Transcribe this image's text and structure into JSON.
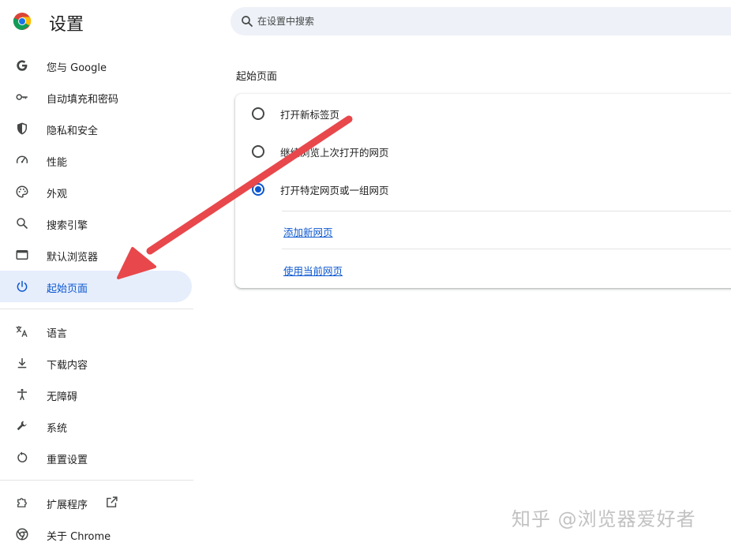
{
  "app": {
    "title": "设置"
  },
  "search": {
    "placeholder": "在设置中搜索",
    "value": ""
  },
  "sidebar": {
    "items": [
      {
        "id": "you-and-google",
        "label": "您与 Google",
        "icon": "google-g-icon"
      },
      {
        "id": "autofill",
        "label": "自动填充和密码",
        "icon": "key-icon"
      },
      {
        "id": "privacy",
        "label": "隐私和安全",
        "icon": "shield-icon"
      },
      {
        "id": "performance",
        "label": "性能",
        "icon": "speedometer-icon"
      },
      {
        "id": "appearance",
        "label": "外观",
        "icon": "palette-icon"
      },
      {
        "id": "search-engine",
        "label": "搜索引擎",
        "icon": "search-icon"
      },
      {
        "id": "default-browser",
        "label": "默认浏览器",
        "icon": "browser-window-icon"
      },
      {
        "id": "on-startup",
        "label": "起始页面",
        "icon": "power-icon",
        "active": true
      },
      {
        "id": "languages",
        "label": "语言",
        "icon": "translate-icon"
      },
      {
        "id": "downloads",
        "label": "下载内容",
        "icon": "download-icon"
      },
      {
        "id": "accessibility",
        "label": "无障碍",
        "icon": "accessibility-icon"
      },
      {
        "id": "system",
        "label": "系统",
        "icon": "wrench-icon"
      },
      {
        "id": "reset",
        "label": "重置设置",
        "icon": "reset-icon"
      },
      {
        "id": "extensions",
        "label": "扩展程序",
        "icon": "puzzle-icon"
      },
      {
        "id": "about",
        "label": "关于 Chrome",
        "icon": "chrome-icon"
      }
    ]
  },
  "main": {
    "section_title": "起始页面",
    "options": [
      {
        "label": "打开新标签页",
        "checked": false
      },
      {
        "label": "继续浏览上次打开的网页",
        "checked": false
      },
      {
        "label": "打开特定网页或一组网页",
        "checked": true
      }
    ],
    "links": {
      "add_new_page": "添加新网页",
      "use_current_pages": "使用当前网页"
    }
  },
  "overlay": {
    "watermark": "知乎 @浏览器爱好者",
    "arrow_color": "#e8474b"
  },
  "colors": {
    "accent": "#0b57d0",
    "active_bg": "#e6eefc",
    "search_bg": "#eef1f7"
  }
}
